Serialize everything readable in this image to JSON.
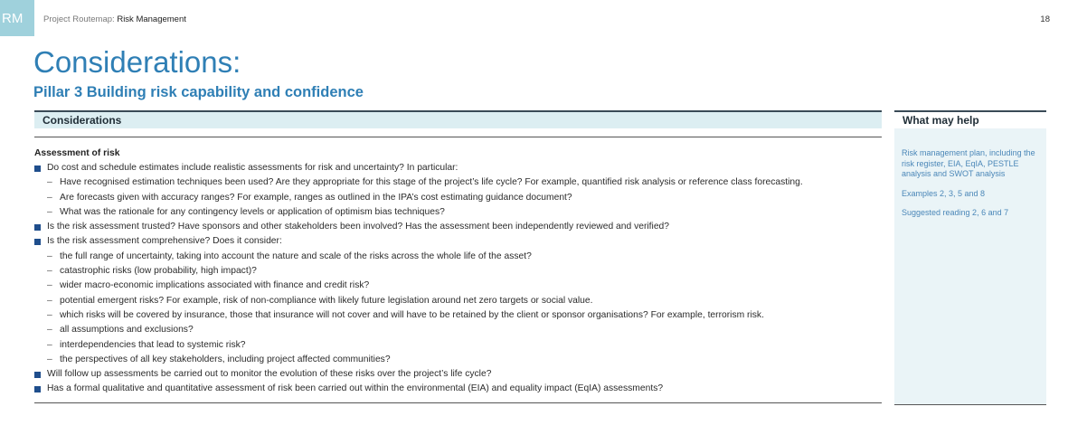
{
  "header": {
    "badge": "RM",
    "breadcrumb_prefix": "Project Routemap: ",
    "breadcrumb_current": "Risk Management",
    "page_number": "18"
  },
  "title": "Considerations:",
  "subtitle": "Pillar 3 Building risk capability and confidence",
  "considerations": {
    "header": "Considerations",
    "section_heading": "Assessment of risk",
    "items": [
      {
        "type": "q",
        "text": "Do cost and schedule estimates include realistic assessments for risk and uncertainty? In particular:"
      },
      {
        "type": "s",
        "text": "Have recognised estimation techniques been used? Are they appropriate for this stage of the project’s life cycle? For example, quantified risk analysis or reference class forecasting."
      },
      {
        "type": "s",
        "text": "Are forecasts given with accuracy ranges? For example, ranges as outlined in the IPA’s cost estimating guidance document?"
      },
      {
        "type": "s",
        "text": "What was the rationale for any contingency levels or application of optimism bias techniques?"
      },
      {
        "type": "q",
        "text": "Is the risk assessment trusted? Have sponsors and other stakeholders been involved? Has the assessment been independently reviewed and verified?"
      },
      {
        "type": "q",
        "text": "Is the risk assessment comprehensive? Does it consider:"
      },
      {
        "type": "s",
        "text": "the full range of uncertainty, taking into account the nature and scale of the risks across the whole life of the asset?"
      },
      {
        "type": "s",
        "text": "catastrophic risks (low probability, high impact)?"
      },
      {
        "type": "s",
        "text": "wider macro-economic implications associated with finance and credit risk?"
      },
      {
        "type": "s",
        "text": "potential emergent risks? For example, risk of non-compliance with likely future legislation around net zero targets or social value."
      },
      {
        "type": "s",
        "text": "which risks will be covered by insurance, those that insurance will not cover and will have to be retained by the client or sponsor organisations? For example, terrorism risk."
      },
      {
        "type": "s",
        "text": "all assumptions and exclusions?"
      },
      {
        "type": "s",
        "text": "interdependencies that lead to systemic risk?"
      },
      {
        "type": "s",
        "text": "the perspectives of all key stakeholders, including project affected communities?"
      },
      {
        "type": "q",
        "text": "Will follow up assessments be carried out to monitor the evolution of these risks over the project’s life cycle?"
      },
      {
        "type": "q",
        "text": "Has a formal qualitative and quantitative assessment of risk been carried out within the environmental (EIA) and equality impact (EqIA) assessments?"
      }
    ]
  },
  "help": {
    "header": "What may help",
    "links": [
      "Risk management plan, including the risk register, EIA, EqIA, PESTLE analysis and SWOT analysis",
      "Examples 2, 3, 5 and 8",
      "Suggested reading 2, 6 and 7"
    ]
  },
  "colors": {
    "title_blue": "#2f7fb5",
    "bullet_navy": "#1f4e8c",
    "badge_teal": "#9fd1dc",
    "header_fill": "#dceef2",
    "help_link": "#4b87b8"
  }
}
